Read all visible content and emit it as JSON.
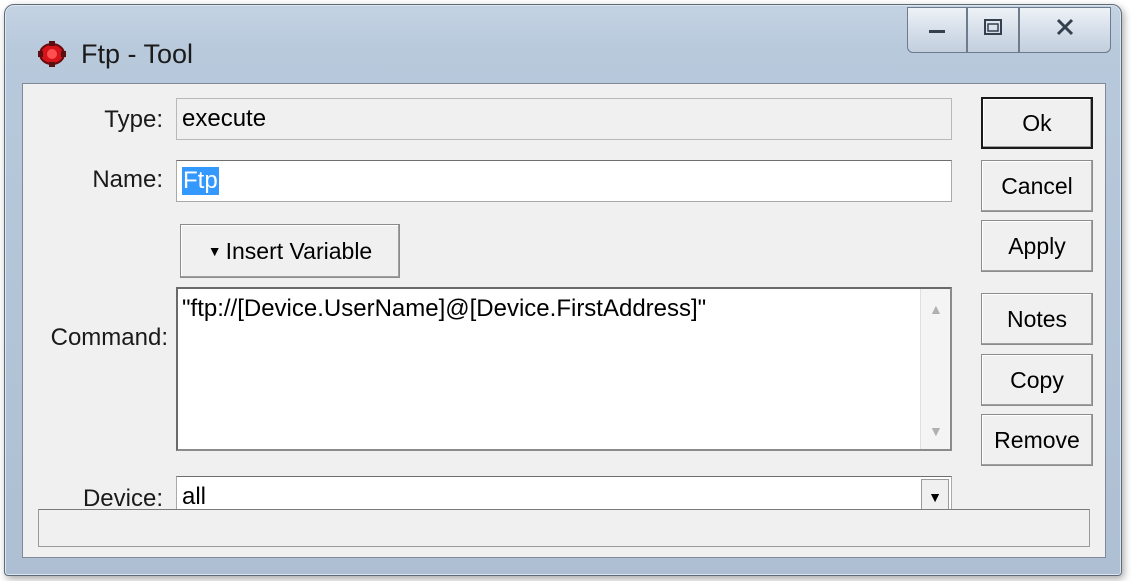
{
  "window": {
    "title": "Ftp - Tool",
    "icon": "red-gear-icon"
  },
  "controls": {
    "minimize_icon": "minimize-icon",
    "maximize_icon": "maximize-icon",
    "close_icon": "close-icon"
  },
  "form": {
    "type_label": "Type:",
    "type_value": "execute",
    "name_label": "Name:",
    "name_value": "Ftp",
    "insert_variable_label": "Insert Variable",
    "command_label": "Command:",
    "command_value": "\"ftp://[Device.UserName]@[Device.FirstAddress]\"",
    "device_label": "Device:",
    "device_value": "all"
  },
  "buttons": {
    "ok": "Ok",
    "cancel": "Cancel",
    "apply": "Apply",
    "notes": "Notes",
    "copy": "Copy",
    "remove": "Remove"
  },
  "colors": {
    "selection": "#3399ff",
    "icon_red": "#d4141a"
  }
}
